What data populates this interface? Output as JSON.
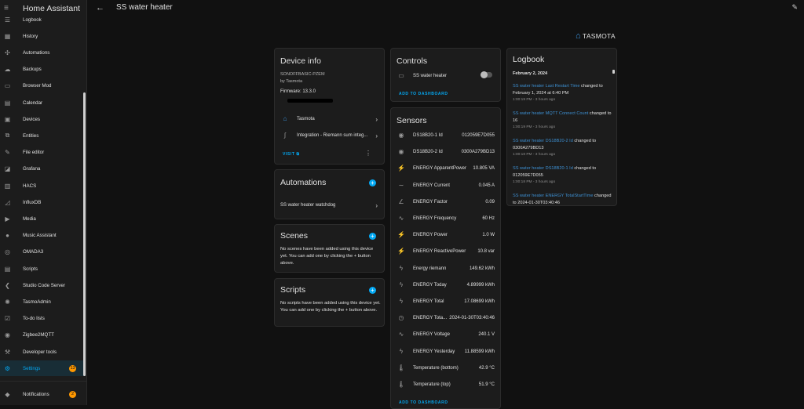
{
  "app": {
    "title": "Home Assistant"
  },
  "sidebar": {
    "items": [
      {
        "label": "Logbook",
        "icon": "logbook-icon",
        "glyph": "☰"
      },
      {
        "label": "History",
        "icon": "history-icon",
        "glyph": "▦"
      },
      {
        "label": "Automations",
        "icon": "automations-icon",
        "glyph": "✣"
      },
      {
        "label": "Backups",
        "icon": "backups-icon",
        "glyph": "☁"
      },
      {
        "label": "Browser Mod",
        "icon": "browser-mod-icon",
        "glyph": "▭"
      },
      {
        "label": "Calendar",
        "icon": "calendar-icon",
        "glyph": "▤"
      },
      {
        "label": "Devices",
        "icon": "devices-icon",
        "glyph": "▣"
      },
      {
        "label": "Entities",
        "icon": "entities-icon",
        "glyph": "⧉"
      },
      {
        "label": "File editor",
        "icon": "file-editor-icon",
        "glyph": "✎"
      },
      {
        "label": "Grafana",
        "icon": "grafana-icon",
        "glyph": "◪"
      },
      {
        "label": "HACS",
        "icon": "hacs-icon",
        "glyph": "▥"
      },
      {
        "label": "InfluxDB",
        "icon": "influxdb-icon",
        "glyph": "◿"
      },
      {
        "label": "Media",
        "icon": "media-icon",
        "glyph": "▶"
      },
      {
        "label": "Music Assistant",
        "icon": "music-assistant-icon",
        "glyph": "●"
      },
      {
        "label": "OMADA3",
        "icon": "omada-icon",
        "glyph": "◎"
      },
      {
        "label": "Scripts",
        "icon": "scripts-icon",
        "glyph": "▤"
      },
      {
        "label": "Studio Code Server",
        "icon": "studio-code-server-icon",
        "glyph": "❮"
      },
      {
        "label": "TasmoAdmin",
        "icon": "tasmoadmin-icon",
        "glyph": "✺"
      },
      {
        "label": "To-do lists",
        "icon": "todo-lists-icon",
        "glyph": "☑"
      },
      {
        "label": "Zigbee2MQTT",
        "icon": "zigbee2mqtt-icon",
        "glyph": "◉"
      },
      {
        "label": "Developer tools",
        "icon": "developer-tools-icon",
        "glyph": "⚒"
      },
      {
        "label": "Settings",
        "icon": "settings-icon",
        "glyph": "⚙",
        "badge": "13",
        "active": true
      }
    ],
    "notifications": {
      "label": "Notifications",
      "icon": "bell-icon",
      "glyph": "🔔",
      "badge": "2"
    }
  },
  "topbar": {
    "title": "SS water heater"
  },
  "brand": {
    "name": "TASMOTA"
  },
  "device_info": {
    "title": "Device info",
    "model": "SONOFFBASIC-PZEM",
    "manufacturer": "by Tasmota",
    "firmware": "Firmware: 13.3.0",
    "links": [
      {
        "label": "Tasmota",
        "icon": "tasmota-icon",
        "glyph": "⌂"
      },
      {
        "label": "Integration - Riemann sum integ...",
        "icon": "integral-icon",
        "glyph": "∫"
      }
    ],
    "visit": "VISIT"
  },
  "automations": {
    "title": "Automations",
    "items": [
      "SS water heater watchdog"
    ]
  },
  "scenes": {
    "title": "Scenes",
    "empty": "No scenes have been added using this device yet. You can add one by clicking the + button above."
  },
  "scripts": {
    "title": "Scripts",
    "empty": "No scripts have been added using this device yet. You can add one by clicking the + button above."
  },
  "controls": {
    "title": "Controls",
    "switch": {
      "label": "SS water heater",
      "on": false
    },
    "add": "ADD TO DASHBOARD"
  },
  "sensors": {
    "title": "Sensors",
    "add": "ADD TO DASHBOARD",
    "rows": [
      {
        "name": "DS18B20-1 Id",
        "value": "012059E7D055",
        "icon": "eye-icon",
        "glyph": "◉"
      },
      {
        "name": "DS18B20-2 Id",
        "value": "0300A279BD13",
        "icon": "eye-icon",
        "glyph": "◉"
      },
      {
        "name": "ENERGY ApparentPower",
        "value": "10.805 VA",
        "icon": "flash-icon",
        "glyph": "⚡"
      },
      {
        "name": "ENERGY Current",
        "value": "0.045 A",
        "icon": "current-icon",
        "glyph": "∼"
      },
      {
        "name": "ENERGY Factor",
        "value": "0.09",
        "icon": "angle-icon",
        "glyph": "∠"
      },
      {
        "name": "ENERGY Frequency",
        "value": "60 Hz",
        "icon": "sine-wave-icon",
        "glyph": "∿"
      },
      {
        "name": "ENERGY Power",
        "value": "1.0 W",
        "icon": "flash-icon",
        "glyph": "⚡"
      },
      {
        "name": "ENERGY ReactivePower",
        "value": "10.8 var",
        "icon": "flash-icon",
        "glyph": "⚡"
      },
      {
        "name": "Energy riemann",
        "value": "149.62 kWh",
        "icon": "lightning-icon",
        "glyph": "ϟ"
      },
      {
        "name": "ENERGY Today",
        "value": "4.89999 kWh",
        "icon": "lightning-icon",
        "glyph": "ϟ"
      },
      {
        "name": "ENERGY Total",
        "value": "17.08699 kWh",
        "icon": "lightning-icon",
        "glyph": "ϟ"
      },
      {
        "name": "ENERGY Tota...",
        "value": "2024-01-30T03:40:46",
        "icon": "clock-icon",
        "glyph": "◷"
      },
      {
        "name": "ENERGY Voltage",
        "value": "240.1 V",
        "icon": "sine-wave-icon",
        "glyph": "∿"
      },
      {
        "name": "ENERGY Yesterday",
        "value": "11.88599 kWh",
        "icon": "lightning-icon",
        "glyph": "ϟ"
      },
      {
        "name": "Temperature (bottom)",
        "value": "42.9 °C",
        "icon": "thermometer-icon",
        "glyph": "🌡"
      },
      {
        "name": "Temperature (top)",
        "value": "51.9 °C",
        "icon": "thermometer-icon",
        "glyph": "🌡"
      }
    ]
  },
  "logbook": {
    "title": "Logbook",
    "date": "February 2, 2024",
    "entries": [
      {
        "link": "SS water heater Last Restart Time",
        "text": " changed to February 1, 2024 at 6:40 PM",
        "time": "1:00:19 PM - 3 hours ago"
      },
      {
        "link": "SS water heater MQTT Connect Count",
        "text": " changed to 16",
        "time": "1:00:19 PM - 3 hours ago"
      },
      {
        "link": "SS water heater DS18B20-2 Id",
        "text": " changed to 0300A279BD13",
        "time": "1:00:18 PM - 3 hours ago"
      },
      {
        "link": "SS water heater DS18B20-1 Id",
        "text": " changed to 012059E7D055",
        "time": "1:00:18 PM - 3 hours ago"
      },
      {
        "link": "SS water heater ENERGY TotalStartTime",
        "text": " changed to 2024-01-30T03:40:46",
        "time": ""
      }
    ]
  }
}
